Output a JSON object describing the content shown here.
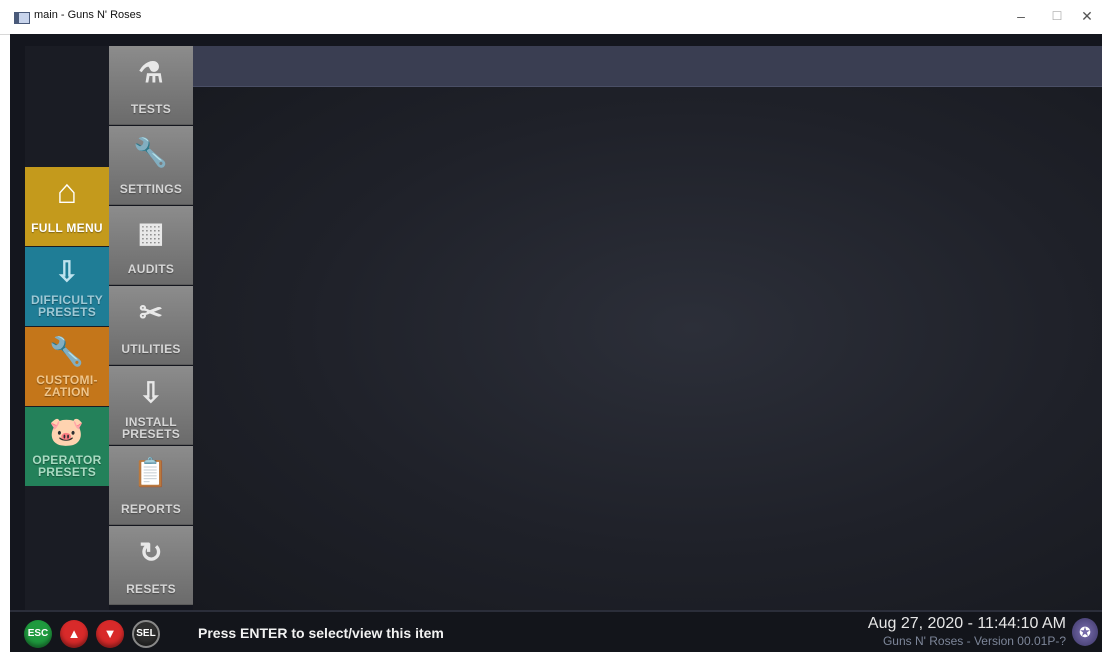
{
  "window": {
    "title": "main - Guns N' Roses",
    "minimize_glyph": "–",
    "maximize_glyph": "☐",
    "close_glyph": "✕"
  },
  "submenu": [
    {
      "label": "TESTS",
      "icon": "test-tube-icon",
      "glyph": "⚗"
    },
    {
      "label": "SETTINGS",
      "icon": "wrench-icon",
      "glyph": "🔧"
    },
    {
      "label": "AUDITS",
      "icon": "calculator-icon",
      "glyph": "▦"
    },
    {
      "label": "UTILITIES",
      "icon": "tools-icon",
      "glyph": "✂"
    },
    {
      "label": "INSTALL\nPRESETS",
      "icon": "download-tray-icon",
      "glyph": "⇩"
    },
    {
      "label": "REPORTS",
      "icon": "clipboard-icon",
      "glyph": "📋"
    },
    {
      "label": "RESETS",
      "icon": "reset-icon",
      "glyph": "↻"
    }
  ],
  "mainmenu": [
    {
      "label": "FULL MENU",
      "icon": "home-icon",
      "glyph": "⌂",
      "color": "#c49a1c"
    },
    {
      "label": "DIFFICULTY\nPRESETS",
      "icon": "download-tray-icon",
      "glyph": "⇩",
      "color": "#1f7d96"
    },
    {
      "label": "CUSTOMI-\nZATION",
      "icon": "wrench-icon",
      "glyph": "🔧",
      "color": "#c4761a"
    },
    {
      "label": "OPERATOR\nPRESETS",
      "icon": "piggy-bank-icon",
      "glyph": "🐷",
      "color": "#23815a"
    }
  ],
  "status": {
    "buttons": [
      {
        "label": "ESC",
        "color": "#1f9a3e"
      },
      {
        "label": "▲",
        "color": "#d82a2a"
      },
      {
        "label": "▼",
        "color": "#d82a2a"
      },
      {
        "label": "SEL",
        "color": "#2f2f2f"
      }
    ],
    "hint": "Press ENTER to select/view this item",
    "datetime": "Aug 27, 2020 - 11:44:10 AM",
    "version": "Guns N' Roses - Version 00.01P-?"
  }
}
